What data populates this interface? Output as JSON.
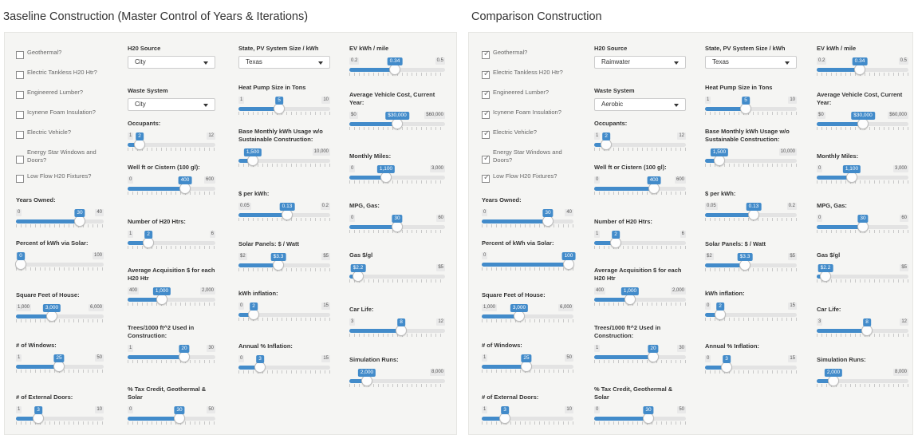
{
  "baseline": {
    "title": "3aseline Construction (Master Control of Years & Iterations)",
    "checkboxes": [
      {
        "label": "Geothermal?",
        "checked": false
      },
      {
        "label": "Electric Tankless H20 Htr?",
        "checked": false
      },
      {
        "label": "Engineered Lumber?",
        "checked": false
      },
      {
        "label": "Icynene Foam Insulation?",
        "checked": false
      },
      {
        "label": "Electric Vehicle?",
        "checked": false
      },
      {
        "label": "Energy Star Windows and Doors?",
        "checked": false
      },
      {
        "label": "Low Flow H20 Fixtures?",
        "checked": false
      }
    ],
    "selects": {
      "h2o_source": "City",
      "waste_system": "City",
      "state": "Texas"
    },
    "sliders": {
      "years_owned": {
        "min": "0",
        "max": "40",
        "value": "30",
        "frac": 0.75
      },
      "pct_solar": {
        "min": "0",
        "max": "100",
        "value": "0",
        "frac": 0
      },
      "sqft": {
        "min": "1,000",
        "max": "6,000",
        "value": "3,000",
        "frac": 0.4
      },
      "windows": {
        "min": "1",
        "max": "50",
        "value": "25",
        "frac": 0.49
      },
      "ext_doors": {
        "min": "1",
        "max": "10",
        "value": "3",
        "frac": 0.22
      },
      "occupants": {
        "min": "1",
        "max": "12",
        "value": "2",
        "frac": 0.09
      },
      "well_ft": {
        "min": "0",
        "max": "600",
        "value": "400",
        "frac": 0.67
      },
      "h2o_htrs": {
        "min": "1",
        "max": "6",
        "value": "2",
        "frac": 0.2
      },
      "avg_acq": {
        "min": "400",
        "max": "2,000",
        "value": "1,000",
        "frac": 0.375
      },
      "trees": {
        "min": "1",
        "max": "30",
        "value": "20",
        "frac": 0.66
      },
      "tax_credit": {
        "min": "0",
        "max": "50",
        "value": "30",
        "frac": 0.6
      },
      "heat_pump": {
        "min": "1",
        "max": "10",
        "value": "5",
        "frac": 0.44
      },
      "kwh_usage": {
        "min": "",
        "max": "10,000",
        "value": "1,500",
        "frac": 0.12
      },
      "per_kwh": {
        "min": "0.05",
        "max": "0.2",
        "value": "0.13",
        "frac": 0.53
      },
      "solar_panels": {
        "min": "$2",
        "max": "$5",
        "value": "$3.3",
        "frac": 0.43
      },
      "kwh_inflation": {
        "min": "0",
        "max": "15",
        "value": "2",
        "frac": 0.13
      },
      "annual_inflation": {
        "min": "0",
        "max": "15",
        "value": "3",
        "frac": 0.2
      },
      "ev_kwh": {
        "min": "0.2",
        "max": "0.5",
        "value": "0.34",
        "frac": 0.47
      },
      "vehicle_cost": {
        "min": "$0",
        "max": "$60,000",
        "value": "$30,000",
        "frac": 0.5
      },
      "monthly_miles": {
        "min": "0",
        "max": "3,000",
        "value": "1,100",
        "frac": 0.37
      },
      "mpg": {
        "min": "0",
        "max": "60",
        "value": "30",
        "frac": 0.5
      },
      "gas": {
        "min": "",
        "max": "$5",
        "value": "$2.2",
        "frac": 0.05
      },
      "car_life": {
        "min": "3",
        "max": "12",
        "value": "8",
        "frac": 0.55
      },
      "sim_runs": {
        "min": "",
        "max": "8,000",
        "value": "2,000",
        "frac": 0.15
      }
    }
  },
  "comparison": {
    "title": "Comparison Construction",
    "checkboxes": [
      {
        "label": "Geothermal?",
        "checked": true
      },
      {
        "label": "Electric Tankless H20 Htr?",
        "checked": true
      },
      {
        "label": "Engineered Lumber?",
        "checked": true
      },
      {
        "label": "Icynene Foam Insulation?",
        "checked": true
      },
      {
        "label": "Electric Vehicle?",
        "checked": true
      },
      {
        "label": "Energy Star Windows and Doors?",
        "checked": true
      },
      {
        "label": "Low Flow H20 Fixtures?",
        "checked": true
      }
    ],
    "selects": {
      "h2o_source": "Rainwater",
      "waste_system": "Aerobic",
      "state": "Texas"
    },
    "sliders": {
      "years_owned": {
        "min": "0",
        "max": "40",
        "value": "30",
        "frac": 0.75
      },
      "pct_solar": {
        "min": "0",
        "max": "100",
        "value": "100",
        "frac": 1
      },
      "sqft": {
        "min": "1,000",
        "max": "6,000",
        "value": "3,000",
        "frac": 0.4
      },
      "windows": {
        "min": "1",
        "max": "50",
        "value": "25",
        "frac": 0.49
      },
      "ext_doors": {
        "min": "1",
        "max": "10",
        "value": "3",
        "frac": 0.22
      },
      "occupants": {
        "min": "1",
        "max": "12",
        "value": "2",
        "frac": 0.09
      },
      "well_ft": {
        "min": "0",
        "max": "600",
        "value": "400",
        "frac": 0.67
      },
      "h2o_htrs": {
        "min": "1",
        "max": "6",
        "value": "2",
        "frac": 0.2
      },
      "avg_acq": {
        "min": "400",
        "max": "2,000",
        "value": "1,000",
        "frac": 0.375
      },
      "trees": {
        "min": "1",
        "max": "30",
        "value": "20",
        "frac": 0.66
      },
      "tax_credit": {
        "min": "0",
        "max": "50",
        "value": "30",
        "frac": 0.6
      },
      "heat_pump": {
        "min": "1",
        "max": "10",
        "value": "5",
        "frac": 0.44
      },
      "kwh_usage": {
        "min": "",
        "max": "10,000",
        "value": "1,500",
        "frac": 0.12
      },
      "per_kwh": {
        "min": "0.05",
        "max": "0.2",
        "value": "0.13",
        "frac": 0.53
      },
      "solar_panels": {
        "min": "$2",
        "max": "$5",
        "value": "$3.3",
        "frac": 0.43
      },
      "kwh_inflation": {
        "min": "0",
        "max": "15",
        "value": "2",
        "frac": 0.13
      },
      "annual_inflation": {
        "min": "0",
        "max": "15",
        "value": "3",
        "frac": 0.2
      },
      "ev_kwh": {
        "min": "0.2",
        "max": "0.5",
        "value": "0.34",
        "frac": 0.47
      },
      "vehicle_cost": {
        "min": "$0",
        "max": "$60,000",
        "value": "$30,000",
        "frac": 0.5
      },
      "monthly_miles": {
        "min": "0",
        "max": "3,000",
        "value": "1,100",
        "frac": 0.37
      },
      "mpg": {
        "min": "0",
        "max": "60",
        "value": "30",
        "frac": 0.5
      },
      "gas": {
        "min": "",
        "max": "$5",
        "value": "$2.2",
        "frac": 0.05
      },
      "car_life": {
        "min": "3",
        "max": "12",
        "value": "8",
        "frac": 0.55
      },
      "sim_runs": {
        "min": "",
        "max": "8,000",
        "value": "2,000",
        "frac": 0.15
      }
    }
  },
  "labels": {
    "h2o_source": "H20 Source",
    "waste_system": "Waste System",
    "state": "State, PV System Size / kWh",
    "years_owned": "Years Owned:",
    "pct_solar": "Percent of kWh via Solar:",
    "sqft": "Square Feet of House:",
    "windows": "# of Windows:",
    "ext_doors": "# of External Doors:",
    "occupants": "Occupants:",
    "well_ft": "Well ft or Cistern (100 gl):",
    "h2o_htrs": "Number of H20 Htrs:",
    "avg_acq": "Average Acquisition $ for each H20 Htr",
    "trees": "Trees/1000 ft^2 Used in Construction:",
    "tax_credit": "% Tax Credit, Geothermal & Solar",
    "heat_pump": "Heat Pump Size in Tons",
    "kwh_usage": "Base Monthly kWh Usage w/o Sustainable Construction:",
    "per_kwh": "$ per kWh:",
    "solar_panels": "Solar Panels: $ / Watt",
    "kwh_inflation": "kWh inflation:",
    "annual_inflation": "Annual % Inflation:",
    "ev_kwh": "EV kWh / mile",
    "vehicle_cost": "Average Vehicle Cost, Current Year:",
    "monthly_miles": "Monthly Miles:",
    "mpg": "MPG, Gas:",
    "gas": "Gas $/gl",
    "car_life": "Car Life:",
    "sim_runs": "Simulation Runs:"
  }
}
